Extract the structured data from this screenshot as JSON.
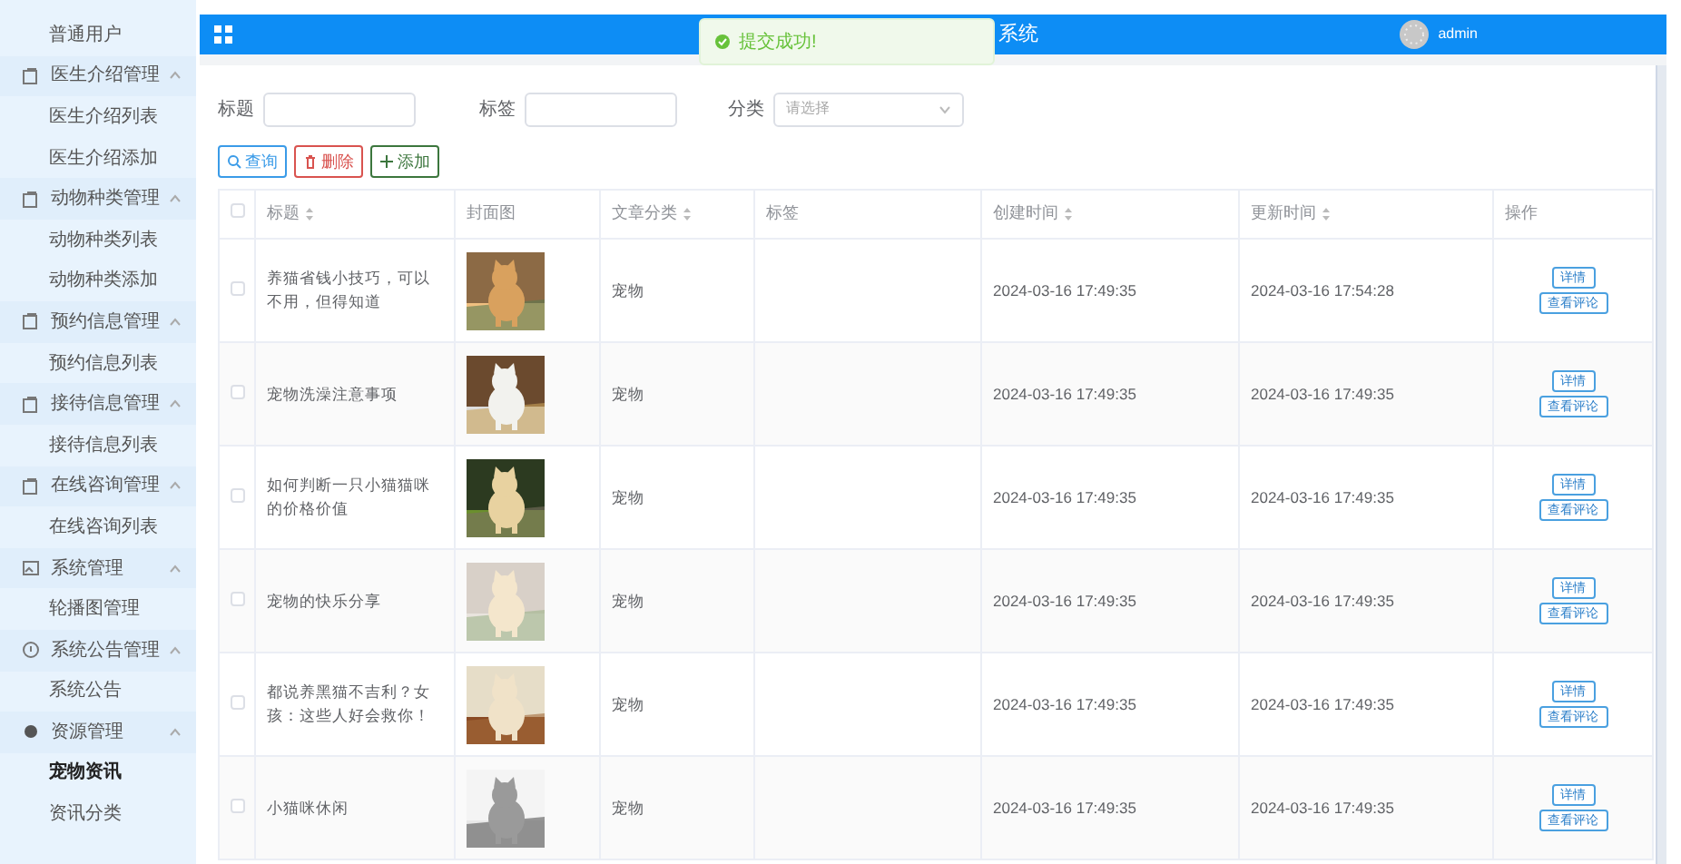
{
  "sidebar": {
    "items": [
      {
        "label": "普通用户",
        "kind": "link",
        "selected": false
      },
      {
        "label": "医生介绍管理",
        "kind": "group",
        "expanded": true,
        "children": [
          {
            "label": "医生介绍列表",
            "selected": false
          },
          {
            "label": "医生介绍添加",
            "selected": false
          }
        ]
      },
      {
        "label": "动物种类管理",
        "kind": "group",
        "expanded": true,
        "children": [
          {
            "label": "动物种类列表",
            "selected": false
          },
          {
            "label": "动物种类添加",
            "selected": false
          }
        ]
      },
      {
        "label": "预约信息管理",
        "kind": "group",
        "expanded": true,
        "children": [
          {
            "label": "预约信息列表",
            "selected": false
          }
        ]
      },
      {
        "label": "接待信息管理",
        "kind": "group",
        "expanded": true,
        "children": [
          {
            "label": "接待信息列表",
            "selected": false
          }
        ]
      },
      {
        "label": "在线咨询管理",
        "kind": "group",
        "expanded": true,
        "children": [
          {
            "label": "在线咨询列表",
            "selected": false
          }
        ]
      },
      {
        "label": "系统管理",
        "kind": "group",
        "expanded": true,
        "children": [
          {
            "label": "轮播图管理",
            "selected": false
          }
        ]
      },
      {
        "label": "系统公告管理",
        "kind": "group",
        "expanded": true,
        "children": [
          {
            "label": "系统公告",
            "selected": false
          }
        ]
      },
      {
        "label": "资源管理",
        "kind": "group",
        "expanded": true,
        "children": [
          {
            "label": "宠物资讯",
            "selected": true
          },
          {
            "label": "资讯分类",
            "selected": false
          }
        ]
      }
    ]
  },
  "header": {
    "title": "系统",
    "user": "admin"
  },
  "toast": {
    "message": "提交成功!"
  },
  "filters": [
    {
      "label": "标题",
      "kind": "input"
    },
    {
      "label": "标签",
      "kind": "input"
    },
    {
      "label": "分类",
      "kind": "select",
      "placeholder": "请选择"
    }
  ],
  "actions": [
    {
      "label": "查询",
      "kind": "search"
    },
    {
      "label": "删除",
      "kind": "delete"
    },
    {
      "label": "添加",
      "kind": "add"
    }
  ],
  "table": {
    "select_all_checked": false,
    "columns": [
      {
        "label": "标题",
        "sortable": true
      },
      {
        "label": "封面图",
        "sortable": false
      },
      {
        "label": "文章分类",
        "sortable": true
      },
      {
        "label": "标签",
        "sortable": false
      },
      {
        "label": "创建时间",
        "sortable": true
      },
      {
        "label": "更新时间",
        "sortable": true
      },
      {
        "label": "操作",
        "sortable": false
      }
    ],
    "rows": [
      {
        "checked": false,
        "title": "养猫省钱小技巧，可以不用，但得知道",
        "cover": {
          "kind": "picture"
        },
        "category": "宠物",
        "created": "2024-03-16 17:49:35",
        "updated": "2024-03-16 17:54:28",
        "buttons": [
          "详情",
          "查看评论"
        ]
      },
      {
        "checked": false,
        "title": "宠物洗澡注意事项",
        "cover": {
          "kind": "picture"
        },
        "category": "宠物",
        "created": "2024-03-16 17:49:35",
        "updated": "2024-03-16 17:49:35",
        "buttons": [
          "详情",
          "查看评论"
        ]
      },
      {
        "checked": false,
        "title": "如何判断一只小猫猫咪的价格价值",
        "cover": {
          "kind": "picture"
        },
        "category": "宠物",
        "created": "2024-03-16 17:49:35",
        "updated": "2024-03-16 17:49:35",
        "buttons": [
          "详情",
          "查看评论"
        ]
      },
      {
        "checked": false,
        "title": "宠物的快乐分享",
        "cover": {
          "kind": "picture"
        },
        "category": "宠物",
        "created": "2024-03-16 17:49:35",
        "updated": "2024-03-16 17:49:35",
        "buttons": [
          "详情",
          "查看评论"
        ]
      },
      {
        "checked": false,
        "title": "都说养黑猫不吉利？女孩：这些人好会救你！",
        "cover": {
          "kind": "picture"
        },
        "category": "宠物",
        "created": "2024-03-16 17:49:35",
        "updated": "2024-03-16 17:49:35",
        "buttons": [
          "详情",
          "查看评论"
        ]
      },
      {
        "checked": false,
        "title": "小猫咪休闲",
        "cover": {
          "kind": "picture"
        },
        "category": "宠物",
        "created": "2024-03-16 17:49:35",
        "updated": "2024-03-16 17:49:35",
        "buttons": [
          "详情",
          "查看评论"
        ]
      }
    ]
  }
}
